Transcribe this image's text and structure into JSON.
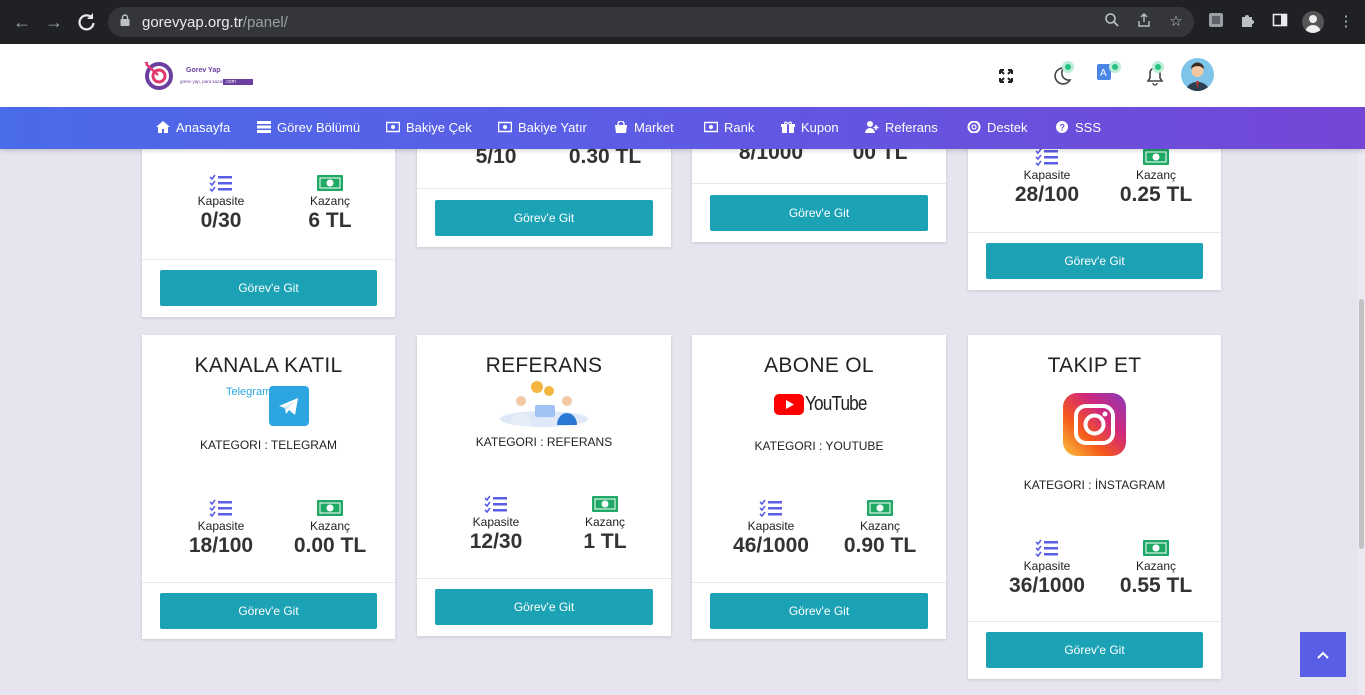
{
  "browser": {
    "url_domain": "gorevyap.org.tr",
    "url_path": "/panel/"
  },
  "logo": {
    "name": "Gorev Yap",
    "tagline": "görev yap, para kazan",
    "badge": ".com"
  },
  "menu": [
    {
      "label": "Anasayfa",
      "icon": "home-icon"
    },
    {
      "label": "Görev Bölümü",
      "icon": "list-icon"
    },
    {
      "label": "Bakiye Çek",
      "icon": "money-icon"
    },
    {
      "label": "Bakiye Yatır",
      "icon": "money-icon"
    },
    {
      "label": "Market",
      "icon": "bag-icon"
    },
    {
      "label": "Rank",
      "icon": "money-icon"
    },
    {
      "label": "Kupon",
      "icon": "gift-icon"
    },
    {
      "label": "Referans",
      "icon": "user-plus-icon"
    },
    {
      "label": "Destek",
      "icon": "lifebuoy-icon"
    },
    {
      "label": "SSS",
      "icon": "question-icon"
    }
  ],
  "labels": {
    "capacity": "Kapasite",
    "earning": "Kazanç",
    "button": "Görev'e Git"
  },
  "top_cards": [
    {
      "capacity": "0/30",
      "earning": "6 TL"
    },
    {
      "capacity": "5/10",
      "earning": "0.30 TL"
    },
    {
      "capacity": "8/1000",
      "earning": "00 TL"
    },
    {
      "capacity": "28/100",
      "earning": "0.25 TL"
    }
  ],
  "bottom_cards": [
    {
      "title": "KANALA KATIL",
      "category": "KATEGORI : TELEGRAM",
      "brand": "Telegram",
      "capacity": "18/100",
      "earning": "0.00 TL"
    },
    {
      "title": "REFERANS",
      "category": "KATEGORI : REFERANS",
      "capacity": "12/30",
      "earning": "1 TL"
    },
    {
      "title": "ABONE OL",
      "category": "KATEGORI : YOUTUBE",
      "brand": "YouTube",
      "capacity": "46/1000",
      "earning": "0.90 TL"
    },
    {
      "title": "TAKIP ET",
      "category": "KATEGORI : İNSTAGRAM",
      "capacity": "36/1000",
      "earning": "0.55 TL"
    }
  ],
  "colors": {
    "accent": "#1ba2b5",
    "menu_start": "#4a6bea",
    "menu_end": "#7446d6",
    "status_dot": "#26c281"
  }
}
